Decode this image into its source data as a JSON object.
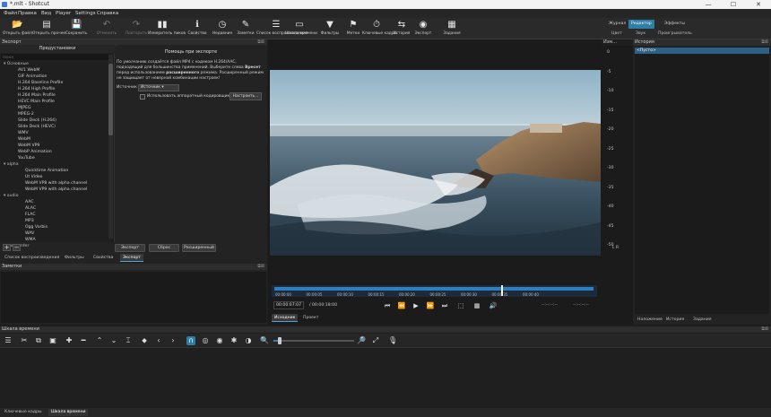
{
  "window": {
    "title": "*.mlt - Shotcut",
    "minimize": "—",
    "maximize": "☐",
    "close": "✕"
  },
  "menu": [
    "Файл",
    "Правка",
    "Вид",
    "Player",
    "Settings",
    "Справка"
  ],
  "toolbar": {
    "items": [
      {
        "label": "Открыть файл",
        "icon": "folder-open-icon",
        "glyph": "📂"
      },
      {
        "label": "Открыть прочее",
        "icon": "open-other-icon",
        "glyph": "▤"
      },
      {
        "label": "Сохранить",
        "icon": "save-icon",
        "glyph": "💾"
      },
      {
        "label": "Отменить",
        "icon": "undo-icon",
        "glyph": "↶"
      },
      {
        "label": "Повторить",
        "icon": "redo-icon",
        "glyph": "↷"
      },
      {
        "label": "Измеритель пиков",
        "icon": "peak-meter-icon",
        "glyph": "▮▮"
      },
      {
        "label": "Свойства",
        "icon": "info-icon",
        "glyph": "ℹ"
      },
      {
        "label": "Недавние",
        "icon": "clock-icon",
        "glyph": "◷"
      },
      {
        "label": "Заметки",
        "icon": "notes-icon",
        "glyph": "✎"
      },
      {
        "label": "Список воспроизведения",
        "icon": "playlist-icon",
        "glyph": "☰"
      },
      {
        "label": "Шкала времени",
        "icon": "timeline-icon",
        "glyph": "▭"
      },
      {
        "label": "Фильтры",
        "icon": "filter-icon",
        "glyph": "▼"
      },
      {
        "label": "Метки",
        "icon": "marker-icon",
        "glyph": "⚑"
      },
      {
        "label": "Ключевые кадры",
        "icon": "stopwatch-icon",
        "glyph": "⏱"
      },
      {
        "label": "История",
        "icon": "history-icon",
        "glyph": "⇆"
      },
      {
        "label": "Экспорт",
        "icon": "export-icon",
        "glyph": "◉"
      },
      {
        "label": "Задания",
        "icon": "jobs-icon",
        "glyph": "▦"
      }
    ],
    "layouts_top": [
      "Журнал",
      "Редактор",
      "Эффекты"
    ],
    "layouts_bottom": [
      "Цвет",
      "Звук",
      "Проигрыватель"
    ],
    "active_layout": "Редактор"
  },
  "export": {
    "panel_title": "Экспорт",
    "presets_header": "Предустановки",
    "search_placeholder": "поиск",
    "presets": [
      {
        "text": "Основные",
        "level": 0
      },
      {
        "text": "AV1 WebM",
        "level": 1
      },
      {
        "text": "GIF Animation",
        "level": 1
      },
      {
        "text": "H.264 Baseline Profile",
        "level": 1
      },
      {
        "text": "H.264 High Profile",
        "level": 1
      },
      {
        "text": "H.264 Main Profile",
        "level": 1
      },
      {
        "text": "HEVC Main Profile",
        "level": 1
      },
      {
        "text": "MJPEG",
        "level": 1
      },
      {
        "text": "MPEG-2",
        "level": 1
      },
      {
        "text": "Slide Deck (H.264)",
        "level": 1
      },
      {
        "text": "Slide Deck (HEVC)",
        "level": 1
      },
      {
        "text": "WMV",
        "level": 1
      },
      {
        "text": "WebM",
        "level": 1
      },
      {
        "text": "WebM VP9",
        "level": 1
      },
      {
        "text": "WebP Animation",
        "level": 1
      },
      {
        "text": "YouTube",
        "level": 1
      },
      {
        "text": "alpha",
        "level": 0
      },
      {
        "text": "Quicktime Animation",
        "level": 2
      },
      {
        "text": "Ut Video",
        "level": 2
      },
      {
        "text": "WebM VP8 with alpha channel",
        "level": 2
      },
      {
        "text": "WebM VP9 with alpha channel",
        "level": 2
      },
      {
        "text": "audio",
        "level": 0
      },
      {
        "text": "AAC",
        "level": 2
      },
      {
        "text": "ALAC",
        "level": 2
      },
      {
        "text": "FLAC",
        "level": 2
      },
      {
        "text": "MP3",
        "level": 2
      },
      {
        "text": "Ogg Vorbis",
        "level": 2
      },
      {
        "text": "WAV",
        "level": 2
      },
      {
        "text": "WMA",
        "level": 2
      },
      {
        "text": "camcorder",
        "level": 0
      }
    ],
    "help_title": "Помощь при экспорте",
    "help_line1": "По умолчанию создаётся файл MP4 с кодеком H.264/AAC,",
    "help_line2": "подходящий для большинства применений. Выберите слева",
    "help_line2b": "Вресет",
    "help_line3": "перед использованием",
    "help_line3b": "расширенного",
    "help_line3c": "режима. Расширенный режим",
    "help_line4": "не защищает от неверной комбинации настроек!",
    "source_label": "Источник",
    "source_value": "Источник",
    "hw_label": "Использовать аппаратный кодировщик",
    "hw_button": "Настроить...",
    "add_btn": "+",
    "remove_btn": "−",
    "export_btn": "Экспорт",
    "reset_btn": "Сброс",
    "advanced_btn": "Расширенный"
  },
  "left_tabs": [
    "Список воспроизведения",
    "Фильтры",
    "Свойства",
    "Экспорт"
  ],
  "left_active_tab": "Экспорт",
  "notes": {
    "title": "Заметки"
  },
  "player": {
    "title": "Изм...",
    "audio_ticks": [
      "0",
      "-5",
      "-10",
      "-15",
      "-20",
      "-25",
      "-30",
      "-35",
      "-40",
      "-45",
      "-50"
    ],
    "audio_lr": "L R",
    "timecodes": [
      "00:00:00",
      "00:00:05",
      "00:00:10",
      "00:00:15",
      "00:00:20",
      "00:00:25",
      "00:00:30",
      "00:00:35",
      "00:00:40"
    ],
    "position": "00:00:07:07",
    "duration": "/ 00:00:18:00",
    "in_point": "--:--:--:--",
    "out_point": "--:--:--:--",
    "tabs": [
      "Исходник",
      "Проект"
    ],
    "active_tab": "Исходник",
    "progress_fraction": 0.71
  },
  "history": {
    "title": "История",
    "items": [
      "<Пусто>"
    ],
    "tabs": [
      "Наложение",
      "История",
      "Задания"
    ]
  },
  "timeline": {
    "title": "Шкала времени",
    "tool_icons": [
      {
        "name": "menu-icon",
        "glyph": "☰"
      },
      {
        "name": "cut-icon",
        "glyph": "✂"
      },
      {
        "name": "copy-icon",
        "glyph": "⧉"
      },
      {
        "name": "paste-icon",
        "glyph": "▣"
      },
      {
        "name": "append-icon",
        "glyph": "✚"
      },
      {
        "name": "remove-icon",
        "glyph": "━"
      },
      {
        "name": "lift-icon",
        "glyph": "⌃"
      },
      {
        "name": "overwrite-icon",
        "glyph": "⌄"
      },
      {
        "name": "split-icon",
        "glyph": "⌶"
      },
      {
        "name": "marker-icon",
        "glyph": "⬥"
      },
      {
        "name": "prev-marker-icon",
        "glyph": "‹"
      },
      {
        "name": "next-marker-icon",
        "glyph": "›"
      },
      {
        "name": "snap-icon",
        "glyph": "∩"
      },
      {
        "name": "scrub-icon",
        "glyph": "◎"
      },
      {
        "name": "ripple-icon",
        "glyph": "◉"
      },
      {
        "name": "ripple-all-icon",
        "glyph": "✱"
      },
      {
        "name": "ripple-markers-icon",
        "glyph": "◑"
      }
    ],
    "zoom_out_icon": "zoom-out-icon",
    "zoom_in_icon": "zoom-in-icon",
    "zoom_fraction": 0.06,
    "bottom_tabs": [
      "Ключевые кадры",
      "Шкала времени"
    ],
    "active_tab": "Шкала времени"
  },
  "colors": {
    "accent": "#2e7ea6",
    "progress": "#2f7fbf",
    "selection": "#2e5f85"
  }
}
